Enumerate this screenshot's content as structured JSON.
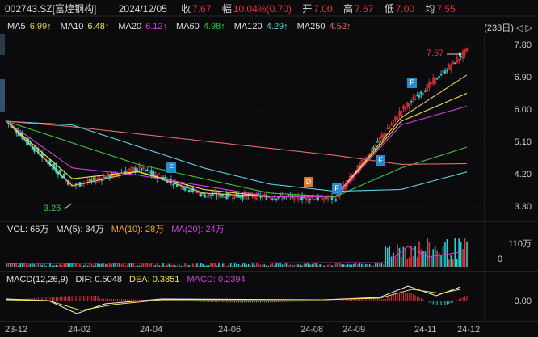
{
  "header": {
    "code": "002743.SZ[富煌钢构]",
    "date": "2024/12/05",
    "close_label": "收",
    "close": "7.67",
    "change_label": "幅",
    "change": "10.04%(0.70)",
    "open_label": "开",
    "open": "7.00",
    "high_label": "高",
    "high": "7.67",
    "low_label": "低",
    "low": "7.00",
    "avg_label": "均",
    "avg": "7.55"
  },
  "ma_legend": [
    {
      "label": "MA5",
      "value": "6.99",
      "arrow": "↑",
      "color": "#e8c75a"
    },
    {
      "label": "MA10",
      "value": "6.48",
      "arrow": "↑",
      "color": "#f0e35a"
    },
    {
      "label": "MA20",
      "value": "6.12",
      "arrow": "↑",
      "color": "#d040d8"
    },
    {
      "label": "MA60",
      "value": "4.98",
      "arrow": "↑",
      "color": "#3cc43c"
    },
    {
      "label": "MA120",
      "value": "4.29",
      "arrow": "↑",
      "color": "#5ad2e0"
    },
    {
      "label": "MA250",
      "value": "4.52",
      "arrow": "↑",
      "color": "#e46b6b"
    }
  ],
  "period_badge": "(233日)",
  "period_arrows": "◁ ▷",
  "price_axis": [
    "7.80",
    "6.90",
    "6.00",
    "5.10",
    "4.20",
    "3.30"
  ],
  "annotations": {
    "high": "7.67",
    "low": "3.26"
  },
  "flags": [
    "F",
    "F",
    "D",
    "F",
    "F"
  ],
  "volume": {
    "title": "VOL: 66万",
    "ma5": "MA(5): 34万",
    "ma10": "MA(10): 28万",
    "ma20": "MA(20): 24万",
    "axis": [
      "110万",
      "0"
    ]
  },
  "macd": {
    "title": "MACD(12,26,9)",
    "dif": "DIF: 0.5048",
    "dea": "DEA: 0.3851",
    "macd": "MACD: 0.2394",
    "axis": [
      "0.00"
    ]
  },
  "dates": [
    "23-12",
    "24-02",
    "24-04",
    "24-06",
    "24-08",
    "24-09",
    "24-11",
    "24-12"
  ],
  "colors": {
    "up": "#e8333b",
    "down": "#2bd0d0",
    "bg": "#0b0b0d"
  },
  "chart_data": {
    "type": "line",
    "title": "",
    "x": [
      "23-12",
      "24-02",
      "24-04",
      "24-06",
      "24-08",
      "24-09",
      "24-11",
      "24-12"
    ],
    "series": [
      {
        "name": "MA5",
        "values": [
          5.7,
          3.9,
          4.3,
          3.7,
          3.6,
          3.6,
          5.8,
          6.99
        ]
      },
      {
        "name": "MA10",
        "values": [
          5.7,
          4.1,
          4.3,
          3.8,
          3.6,
          3.6,
          5.7,
          6.48
        ]
      },
      {
        "name": "MA20",
        "values": [
          5.7,
          4.4,
          4.2,
          3.9,
          3.6,
          3.6,
          5.6,
          6.12
        ]
      },
      {
        "name": "MA60",
        "values": [
          5.7,
          5.1,
          4.5,
          4.1,
          3.7,
          3.6,
          4.4,
          4.98
        ]
      },
      {
        "name": "MA120",
        "values": [
          5.7,
          5.6,
          5.0,
          4.4,
          3.95,
          3.75,
          3.8,
          4.29
        ]
      },
      {
        "name": "MA250",
        "values": [
          5.7,
          5.55,
          5.35,
          5.15,
          4.95,
          4.75,
          4.5,
          4.52
        ]
      },
      {
        "name": "Close",
        "values": [
          5.7,
          3.9,
          4.4,
          3.65,
          3.6,
          3.55,
          6.0,
          7.67
        ]
      }
    ],
    "ylim": [
      3.0,
      8.0
    ],
    "price_ticks": [
      7.8,
      6.9,
      6.0,
      5.1,
      4.2,
      3.3
    ]
  }
}
